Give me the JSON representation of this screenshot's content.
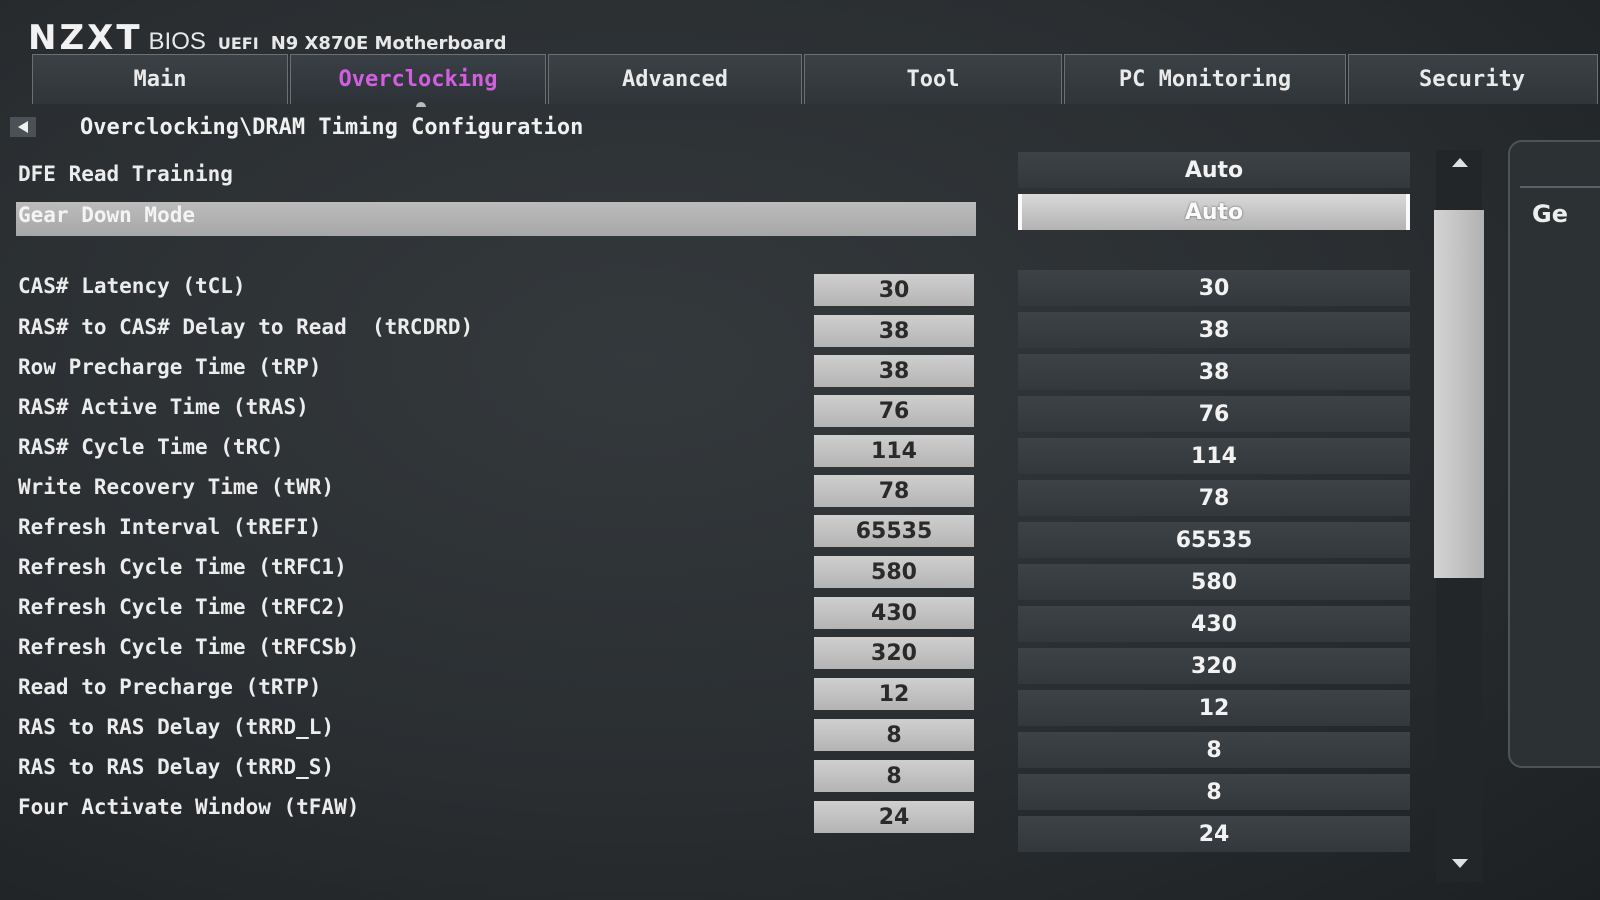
{
  "header": {
    "logo": "NZXT",
    "bios_label": "BIOS",
    "uefi_label": "UEFI",
    "board_name": "N9 X870E Motherboard"
  },
  "tabs": [
    {
      "label": "Main",
      "active": false
    },
    {
      "label": "Overclocking",
      "active": true
    },
    {
      "label": "Advanced",
      "active": false
    },
    {
      "label": "Tool",
      "active": false
    },
    {
      "label": "PC Monitoring",
      "active": false
    },
    {
      "label": "Security",
      "active": false
    }
  ],
  "breadcrumb": "Overclocking\\DRAM Timing Configuration",
  "options": {
    "dfe": {
      "label": "DFE Read Training",
      "value": "Auto"
    },
    "gear": {
      "label": "Gear Down Mode",
      "value": "Auto"
    }
  },
  "timings": [
    {
      "label": "CAS# Latency (tCL)",
      "current": "30",
      "setting": "30"
    },
    {
      "label": "RAS# to CAS# Delay to Read  (tRCDRD)",
      "current": "38",
      "setting": "38"
    },
    {
      "label": "Row Precharge Time (tRP)",
      "current": "38",
      "setting": "38"
    },
    {
      "label": "RAS# Active Time (tRAS)",
      "current": "76",
      "setting": "76"
    },
    {
      "label": "RAS# Cycle Time (tRC)",
      "current": "114",
      "setting": "114"
    },
    {
      "label": "Write Recovery Time (tWR)",
      "current": "78",
      "setting": "78"
    },
    {
      "label": "Refresh Interval (tREFI)",
      "current": "65535",
      "setting": "65535"
    },
    {
      "label": "Refresh Cycle Time (tRFC1)",
      "current": "580",
      "setting": "580"
    },
    {
      "label": "Refresh Cycle Time (tRFC2)",
      "current": "430",
      "setting": "430"
    },
    {
      "label": "Refresh Cycle Time (tRFCSb)",
      "current": "320",
      "setting": "320"
    },
    {
      "label": "Read to Precharge (tRTP)",
      "current": "12",
      "setting": "12"
    },
    {
      "label": "RAS to RAS Delay (tRRD_L)",
      "current": "8",
      "setting": "8"
    },
    {
      "label": "RAS to RAS Delay (tRRD_S)",
      "current": "8",
      "setting": "8"
    },
    {
      "label": "Four Activate Window (tFAW)",
      "current": "24",
      "setting": "24"
    }
  ],
  "help_panel": {
    "text": "Ge"
  },
  "icons": {
    "back": "left-triangle-icon",
    "scroll_up": "up-triangle-icon",
    "scroll_down": "down-triangle-icon"
  },
  "colors": {
    "active_tab": "#d25fe0",
    "highlight": "#b5b5b5"
  }
}
